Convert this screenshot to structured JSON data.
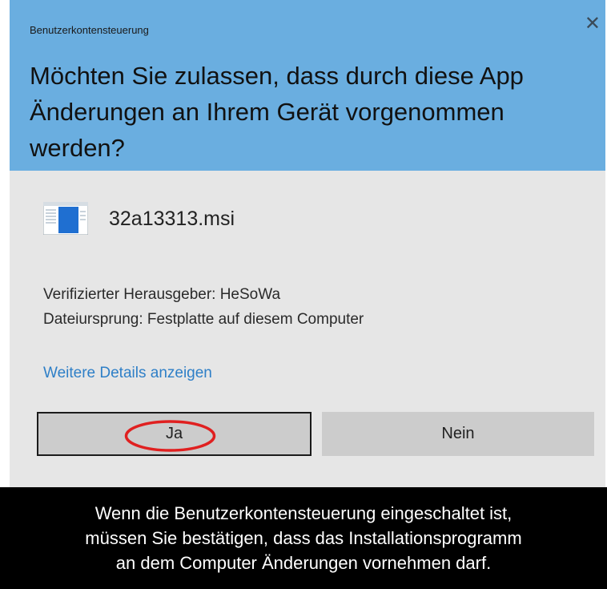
{
  "dialog": {
    "caption": "Benutzerkontensteuerung",
    "question_lines": [
      "Möchten Sie zulassen, dass durch diese App",
      "Änderungen an Ihrem Gerät vorgenommen",
      "werden?"
    ],
    "file_name": "32a13313.msi",
    "file_icon": "msi-installer-icon",
    "close_icon": "close-icon",
    "publisher": "Verifizierter Herausgeber: HeSoWa",
    "origin": "Dateiursprung: Festplatte auf diesem Computer",
    "details_link": "Weitere Details anzeigen",
    "yes_label": "Ja",
    "no_label": "Nein",
    "header_color": "#6aaee0",
    "body_color": "#e6e6e6",
    "highlight_color": "#e02020"
  },
  "caption_lines": [
    "Wenn die Benutzerkontensteuerung eingeschaltet ist,",
    "müssen Sie bestätigen, dass das Installationsprogramm",
    "an dem Computer Änderungen vornehmen darf."
  ]
}
